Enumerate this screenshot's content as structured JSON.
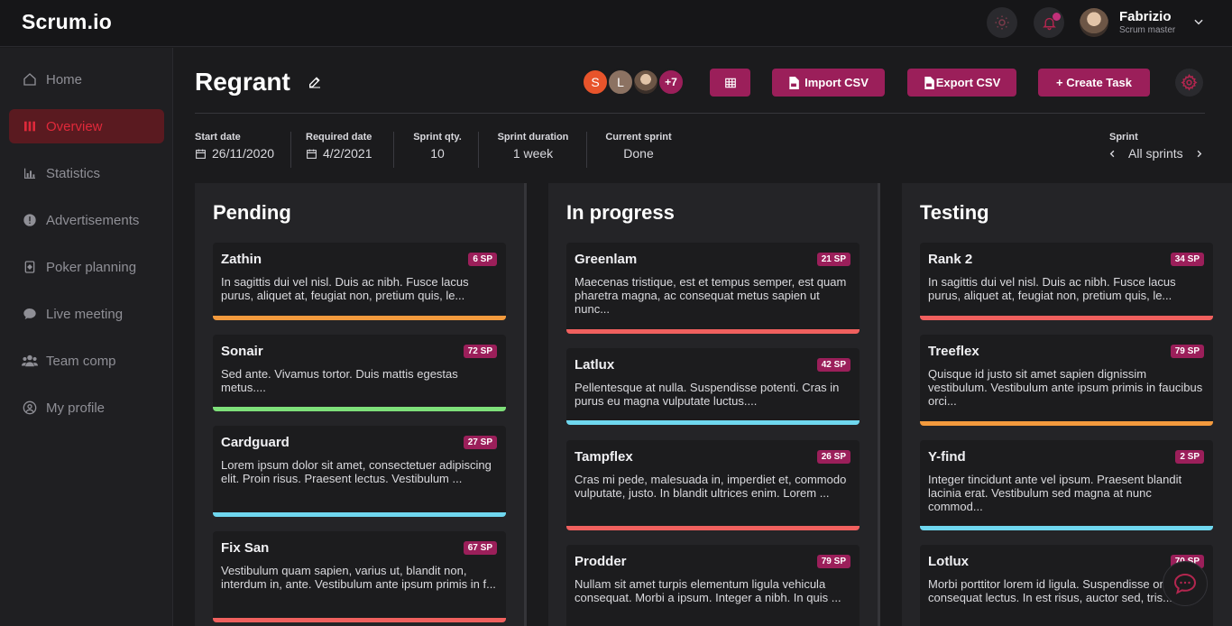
{
  "app": {
    "logo": "Scrum.io"
  },
  "user": {
    "name": "Fabrizio",
    "role": "Scrum master"
  },
  "colors": {
    "accent": "#9b1f5a",
    "active_nav": "#e0293a",
    "orange": "#f39a3d",
    "green": "#7ee07a",
    "cyan": "#6fd7ef",
    "red": "#f0605e"
  },
  "sidebar": {
    "items": [
      {
        "label": "Home",
        "icon": "home-icon"
      },
      {
        "label": "Overview",
        "icon": "bars-icon",
        "active": true
      },
      {
        "label": "Statistics",
        "icon": "chart-icon"
      },
      {
        "label": "Advertisements",
        "icon": "alert-icon"
      },
      {
        "label": "Poker planning",
        "icon": "card-icon"
      },
      {
        "label": "Live meeting",
        "icon": "chat-icon"
      },
      {
        "label": "Team comp",
        "icon": "team-icon"
      },
      {
        "label": "My profile",
        "icon": "user-icon"
      }
    ]
  },
  "project": {
    "title": "Regrant",
    "members": [
      "S",
      "L"
    ],
    "members_more": "+7",
    "import_label": "Import CSV",
    "export_label": "Export CSV",
    "create_label": "+ Create Task"
  },
  "meta": {
    "start_label": "Start date",
    "start_value": "26/11/2020",
    "required_label": "Required date",
    "required_value": "4/2/2021",
    "qty_label": "Sprint qty.",
    "qty_value": "10",
    "duration_label": "Sprint duration",
    "duration_value": "1 week",
    "current_label": "Current sprint",
    "current_value": "Done",
    "sprint_label": "Sprint",
    "sprint_value": "All sprints"
  },
  "columns": [
    {
      "title": "Pending",
      "cards": [
        {
          "title": "Zathin",
          "sp": "6 SP",
          "desc": "In sagittis dui vel nisl. Duis ac nibh. Fusce lacus purus, aliquet at, feugiat non, pretium quis, le...",
          "color": "#f39a3d"
        },
        {
          "title": "Sonair",
          "sp": "72 SP",
          "desc": "Sed ante. Vivamus tortor. Duis mattis egestas metus....",
          "color": "#7ee07a"
        },
        {
          "title": "Cardguard",
          "sp": "27 SP",
          "desc": "Lorem ipsum dolor sit amet, consectetuer adipiscing elit. Proin risus. Praesent lectus. Vestibulum ...",
          "color": "#6fd7ef"
        },
        {
          "title": "Fix San",
          "sp": "67 SP",
          "desc": "Vestibulum quam sapien, varius ut, blandit non, interdum in, ante. Vestibulum ante ipsum primis in f...",
          "color": "#f0605e"
        }
      ]
    },
    {
      "title": "In progress",
      "cards": [
        {
          "title": "Greenlam",
          "sp": "21 SP",
          "desc": "Maecenas tristique, est et tempus semper, est quam pharetra magna, ac consequat metus sapien ut nunc...",
          "color": "#f0605e"
        },
        {
          "title": "Latlux",
          "sp": "42 SP",
          "desc": "Pellentesque at nulla. Suspendisse potenti. Cras in purus eu magna vulputate luctus....",
          "color": "#6fd7ef"
        },
        {
          "title": "Tampflex",
          "sp": "26 SP",
          "desc": "Cras mi pede, malesuada in, imperdiet et, commodo vulputate, justo. In blandit ultrices enim. Lorem ...",
          "color": "#f0605e"
        },
        {
          "title": "Prodder",
          "sp": "79 SP",
          "desc": "Nullam sit amet turpis elementum ligula vehicula consequat. Morbi a ipsum. Integer a nibh. In quis ...",
          "color": "#f0605e"
        }
      ]
    },
    {
      "title": "Testing",
      "cards": [
        {
          "title": "Rank 2",
          "sp": "34 SP",
          "desc": "In sagittis dui vel nisl. Duis ac nibh. Fusce lacus purus, aliquet at, feugiat non, pretium quis, le...",
          "color": "#f0605e"
        },
        {
          "title": "Treeflex",
          "sp": "79 SP",
          "desc": "Quisque id justo sit amet sapien dignissim vestibulum. Vestibulum ante ipsum primis in faucibus orci...",
          "color": "#f39a3d"
        },
        {
          "title": "Y-find",
          "sp": "2 SP",
          "desc": "Integer tincidunt ante vel ipsum. Praesent blandit lacinia erat. Vestibulum sed magna at nunc commod...",
          "color": "#6fd7ef"
        },
        {
          "title": "Lotlux",
          "sp": "70 SP",
          "desc": "Morbi porttitor lorem id ligula. Suspendisse ornare consequat lectus. In est risus, auctor sed, tris...",
          "color": "#f0605e"
        }
      ]
    }
  ]
}
